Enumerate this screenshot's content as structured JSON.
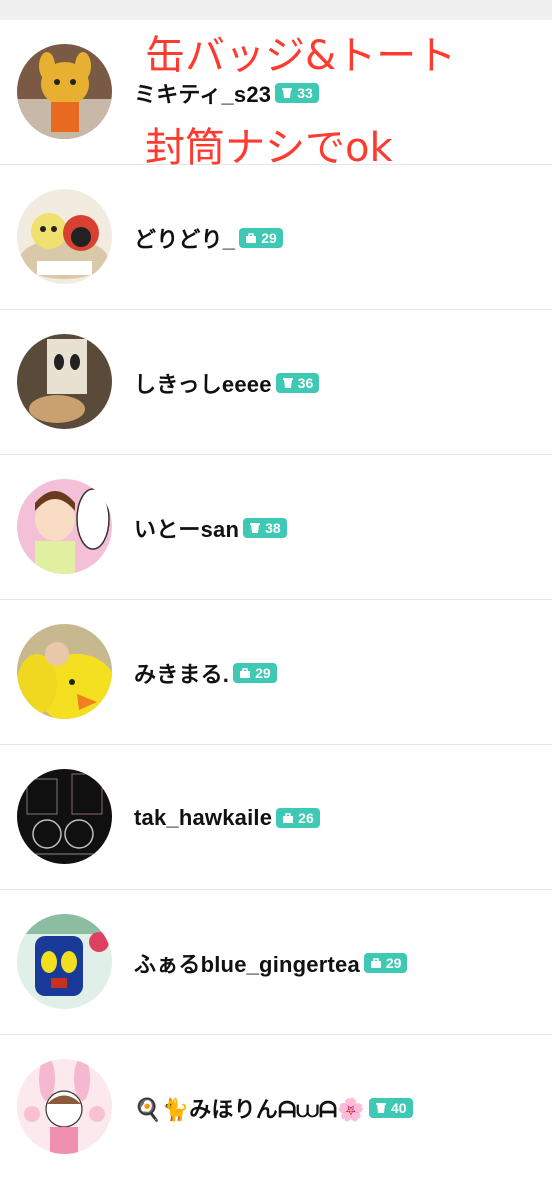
{
  "annotation": {
    "line1": "缶バッジ&トート",
    "line2": "封筒ナシでok"
  },
  "users": [
    {
      "name": "ミキティ_s23",
      "badge_icon": "drink-cup-icon",
      "badge_count": "33"
    },
    {
      "name": "どりどり_",
      "badge_icon": "bag-icon",
      "badge_count": "29"
    },
    {
      "name": "しきっしeeee",
      "badge_icon": "drink-cup-icon",
      "badge_count": "36"
    },
    {
      "name": "いとーsan",
      "badge_icon": "drink-cup-icon",
      "badge_count": "38"
    },
    {
      "name": "みきまる.",
      "badge_icon": "bag-icon",
      "badge_count": "29"
    },
    {
      "name": "tak_hawkaile",
      "badge_icon": "bag-icon",
      "badge_count": "26"
    },
    {
      "name": "ふぁるblue_gingertea",
      "badge_icon": "bag-icon",
      "badge_count": "29"
    },
    {
      "name": "🍳🐈みほりんᗩ⩊ᗩ🌸",
      "badge_icon": "drink-cup-icon",
      "badge_count": "40"
    }
  ],
  "colors": {
    "badge": "#3ec9b4",
    "annotation": "#ff3b30"
  }
}
